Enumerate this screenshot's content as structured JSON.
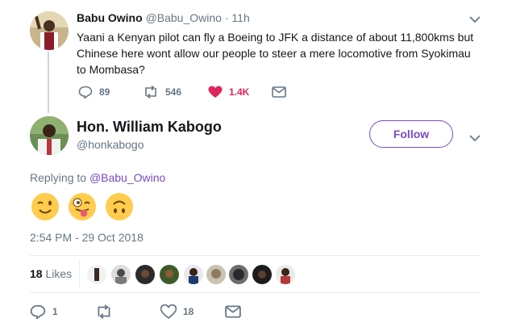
{
  "parent": {
    "name": "Babu Owino",
    "handle": "@Babu_Owino",
    "separator": "·",
    "time": "11h",
    "text": "Yaani a Kenyan pilot can fly a Boeing to JFK  a distance of about 11,800kms but Chinese here wont allow our people to steer a mere locomotive from Syokimau to Mombasa?",
    "replies": "89",
    "retweets": "546",
    "likes": "1.4K"
  },
  "author": {
    "name": "Hon. William Kabogo",
    "handle": "@honkabogo",
    "follow_label": "Follow"
  },
  "reply": {
    "prefix": "Replying to",
    "to_handle": "@Babu_Owino"
  },
  "emojis": [
    "winking-face",
    "face-with-tongue",
    "upside-down-face"
  ],
  "timestamp": "2:54 PM - 29 Oct 2018",
  "stats": {
    "likes_count": "18",
    "likes_label": "Likes"
  },
  "actions": {
    "replies": "1",
    "retweets": "",
    "likes": "18"
  },
  "colors": {
    "accent": "#794bc4",
    "like_red": "#e0245e",
    "muted": "#657786",
    "text": "#14171a",
    "divider": "#e6ecf0"
  }
}
